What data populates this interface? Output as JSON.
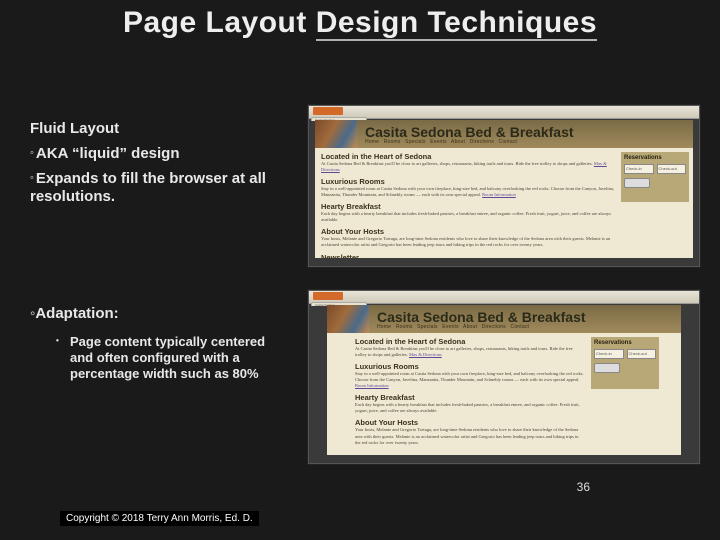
{
  "title_prefix": "Page Layout ",
  "title_underlined": "Design Techniques",
  "heading": "Fluid Layout",
  "bullet1": "AKA “liquid” design",
  "bullet2": "Expands to fill the browser at all resolutions.",
  "bullet3": "Adaptation:",
  "sub_bullet": "Page content typically centered and often configured with a percentage width such as 80%",
  "page_num": "36",
  "copyright": "Copyright © 2018 Terry Ann Morris, Ed. D.",
  "mock": {
    "site_title": "Casita Sedona Bed & Breakfast",
    "nav": "Home   Rooms   Specials   Events   About   Directions   Contact",
    "tab": "Casita Sedona",
    "reserve": "Reservations",
    "checkin": "Check-in",
    "checkout": "Check-out",
    "sections": {
      "s1h": "Located in the Heart of Sedona",
      "s1p": "At Casita Sedona Bed & Breakfast you'll be close to art galleries, shops, restaurants, hiking trails and tours. Ride the free trolley to shops and galleries.",
      "s1l": "Max & Directions",
      "s2h": "Luxurious Rooms",
      "s2p": "Stay in a well-appointed room at Casita Sedona with your own fireplace, king-size bed, and balcony overlooking the red rocks. Choose from the Canyon, Javelina, Manzanita, Thunder Mountain, and Schnebly rooms — each with its own special appeal.",
      "s2l": "Room Information",
      "s3h": "Hearty Breakfast",
      "s3p": "Each day begins with a hearty breakfast that includes fresh-baked pastries, a breakfast entree, and organic coffee. Fresh fruit, yogurt, juice, and coffee are always available.",
      "s4h": "About Your Hosts",
      "s4p": "Your hosts, Melanie and Gregorio Tortuga, are long-time Sedona residents who love to share their knowledge of the Sedona area with their guests. Melanie is an acclaimed watercolor artist and Gregorio has been leading jeep tours and hiking trips in the red rocks for over twenty years.",
      "s5h": "Newsletter"
    }
  }
}
